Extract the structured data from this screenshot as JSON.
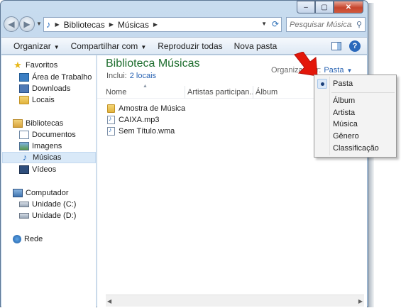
{
  "window": {
    "caption_buttons": [
      "–",
      "▢",
      "✕"
    ]
  },
  "address": {
    "path": [
      "Bibliotecas",
      "Músicas"
    ],
    "search_placeholder": "Pesquisar Músicas"
  },
  "toolbar": {
    "organize_label": "Organizar",
    "share_label": "Compartilhar com",
    "play_all_label": "Reproduzir todas",
    "new_folder_label": "Nova pasta"
  },
  "sidebar": {
    "favorites": {
      "label": "Favoritos",
      "items": [
        {
          "label": "Área de Trabalho",
          "icon": "desktop-icon"
        },
        {
          "label": "Downloads",
          "icon": "downloads-icon"
        },
        {
          "label": "Locais",
          "icon": "recent-places-icon"
        }
      ]
    },
    "libraries": {
      "label": "Bibliotecas",
      "items": [
        {
          "label": "Documentos",
          "icon": "documents-icon"
        },
        {
          "label": "Imagens",
          "icon": "pictures-icon"
        },
        {
          "label": "Músicas",
          "icon": "music-icon",
          "selected": true
        },
        {
          "label": "Vídeos",
          "icon": "videos-icon"
        }
      ]
    },
    "computer": {
      "label": "Computador",
      "items": [
        {
          "label": "Unidade (C:)",
          "icon": "drive-icon"
        },
        {
          "label": "Unidade (D:)",
          "icon": "drive-icon"
        }
      ]
    },
    "network": {
      "label": "Rede"
    }
  },
  "library": {
    "title": "Biblioteca Músicas",
    "includes_label": "Inclui:",
    "includes_link": "2 locais",
    "arrange_label": "Organizar por:",
    "arrange_value": "Pasta"
  },
  "columns": [
    "Nome",
    "Artistas participan...",
    "Álbum"
  ],
  "files": [
    {
      "name": "Amostra de Música",
      "type": "folder"
    },
    {
      "name": "CAIXA.mp3",
      "type": "audio"
    },
    {
      "name": "Sem Título.wma",
      "type": "audio"
    }
  ],
  "arrange_menu": {
    "selected": "Pasta",
    "items": [
      "Pasta",
      "Álbum",
      "Artista",
      "Música",
      "Gênero",
      "Classificação"
    ]
  },
  "annotation": {
    "color": "#e3170a"
  }
}
